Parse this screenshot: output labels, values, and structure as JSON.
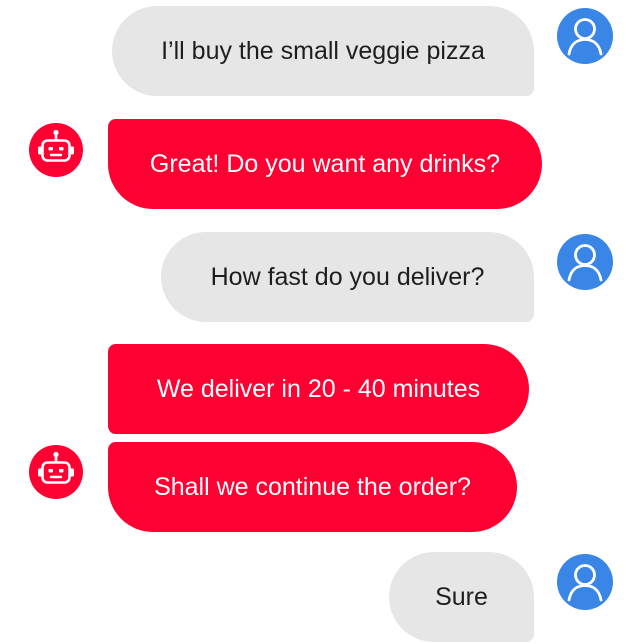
{
  "colors": {
    "bot_bubble": "#ff0033",
    "user_bubble": "#e6e6e6",
    "user_avatar": "#3a86e6",
    "bot_avatar": "#ff0033"
  },
  "messages": [
    {
      "sender": "user",
      "text": "I’ll buy the small veggie pizza",
      "avatar_icon": "user-icon"
    },
    {
      "sender": "bot",
      "text": "Great! Do you want any drinks?",
      "avatar_icon": "robot-icon"
    },
    {
      "sender": "user",
      "text": "How fast do you deliver?",
      "avatar_icon": "user-icon"
    },
    {
      "sender": "bot",
      "text": "We deliver in 20 - 40 minutes"
    },
    {
      "sender": "bot",
      "text": "Shall we continue the order?",
      "avatar_icon": "robot-icon"
    },
    {
      "sender": "user",
      "text": "Sure",
      "avatar_icon": "user-icon"
    }
  ]
}
